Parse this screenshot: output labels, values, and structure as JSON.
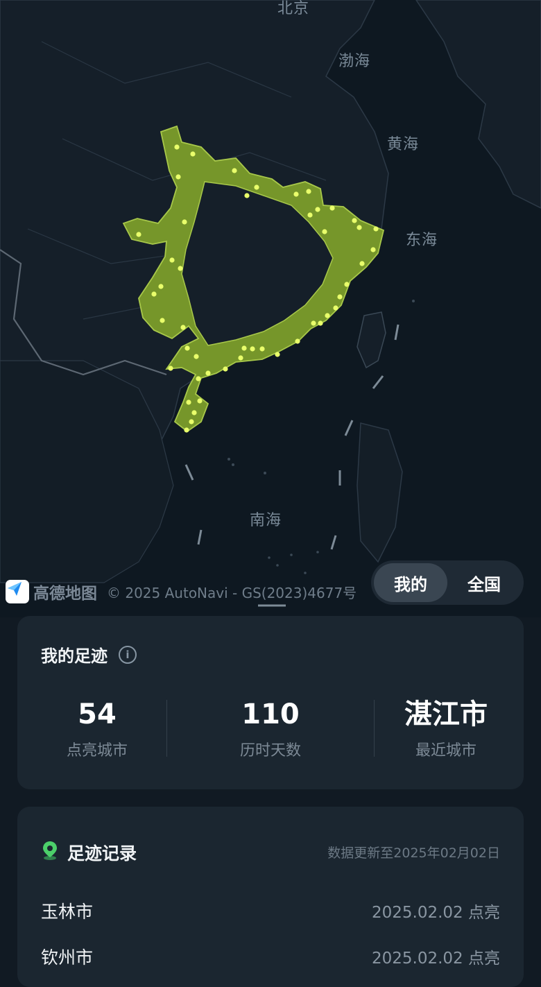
{
  "map": {
    "labels": {
      "beijing": "北京",
      "bohai": "渤海",
      "huanghai": "黄海",
      "donghai": "东海",
      "nanhai": "南海"
    },
    "attribution": {
      "brand": "高德地图",
      "copyright": "© 2025 AutoNavi - GS(2023)4677号"
    },
    "colors": {
      "visited_fill": "#7a9a2a",
      "visited_stroke": "#a8c84a",
      "city_dot": "#e9ff6b",
      "background": "#0e1821"
    }
  },
  "toggle": {
    "mine_label": "我的",
    "all_label": "全国",
    "selected": "我的"
  },
  "stats": {
    "title": "我的足迹",
    "items": [
      {
        "value": "54",
        "label": "点亮城市"
      },
      {
        "value": "110",
        "label": "历时天数"
      },
      {
        "value": "湛江市",
        "label": "最近城市"
      }
    ]
  },
  "records": {
    "title": "足迹记录",
    "updated": "数据更新至2025年02月02日",
    "rows": [
      {
        "city": "玉林市",
        "date": "2025.02.02 点亮"
      },
      {
        "city": "钦州市",
        "date": "2025.02.02 点亮"
      }
    ]
  }
}
